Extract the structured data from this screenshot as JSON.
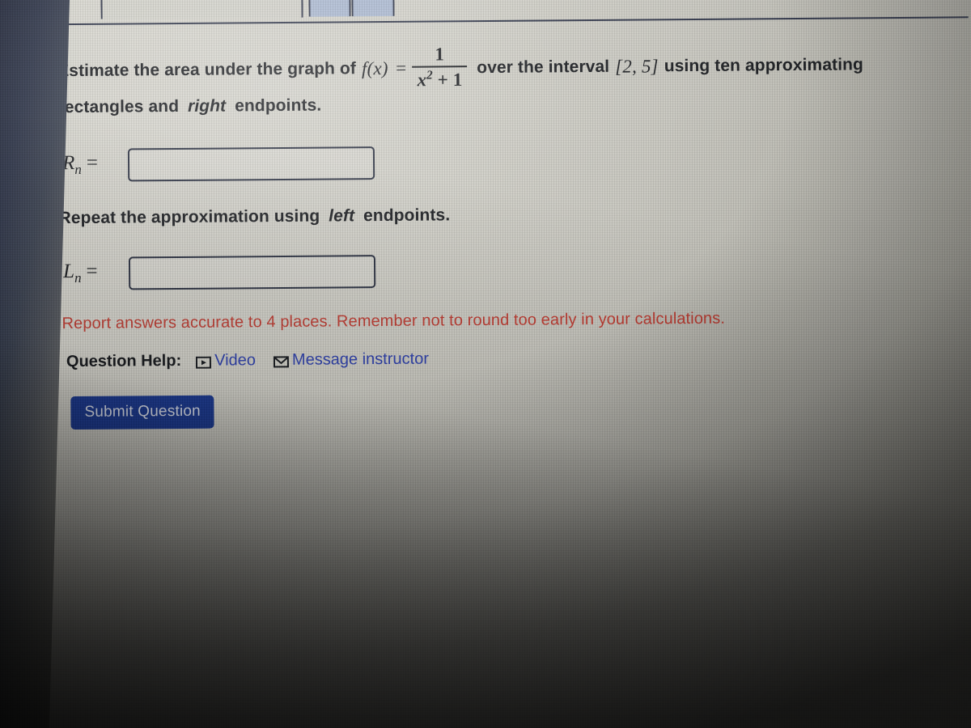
{
  "browser_chrome": {
    "tab_placeholder": "",
    "button_a_label": "",
    "button_b_label": ""
  },
  "question": {
    "line1_part1": "Estimate the area under the graph of",
    "fx_label": "f(x)",
    "equals": "=",
    "fraction": {
      "numerator": "1",
      "denominator_base": "x",
      "denominator_exponent": "2",
      "denominator_tail": "+ 1"
    },
    "line1_part2": "over the interval",
    "interval": "[2, 5]",
    "line1_part3": "using ten approximating",
    "line2_pre": "rectangles and",
    "line2_em": "right",
    "line2_post": "endpoints."
  },
  "answers": {
    "rn": {
      "label_base": "R",
      "label_sub": "n",
      "equals": "=",
      "value": "",
      "placeholder": ""
    },
    "ln": {
      "label_base": "L",
      "label_sub": "n",
      "equals": "=",
      "value": "",
      "placeholder": ""
    }
  },
  "repeat_instruction": {
    "pre": "Repeat the approximation using",
    "em": "left",
    "post": "endpoints."
  },
  "accuracy_note": "Report answers accurate to 4 places. Remember not to round too early in your calculations.",
  "help": {
    "label": "Question Help:",
    "video_label": "Video",
    "video_icon": "play-in-box-icon",
    "message_label": "Message instructor",
    "message_icon": "envelope-icon"
  },
  "submit": {
    "label": "Submit Question"
  },
  "colors": {
    "link_blue": "#2c3fae",
    "note_red": "#c0392f",
    "submit_blue": "#1b3a94",
    "border_navy": "#262c3d",
    "text_dark": "#16181c",
    "chrome_tab_blue": "#a8b6cf"
  }
}
